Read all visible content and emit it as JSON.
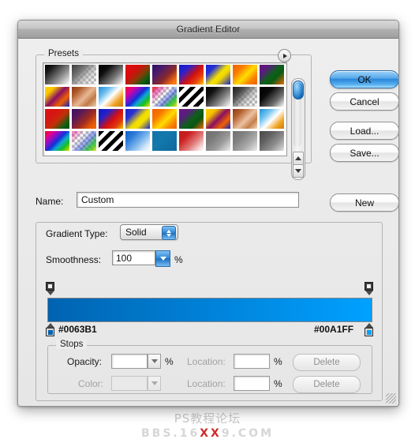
{
  "window": {
    "title": "Gradient Editor"
  },
  "presets": {
    "label": "Presets",
    "flyout_icon": "triangle-right-icon",
    "scrollbar": {
      "up_icon": "triangle-up-icon",
      "down_icon": "triangle-down-icon"
    },
    "swatches": [
      {
        "name": "black-white",
        "css": "linear-gradient(135deg,#000000 0%,#1a1a1a 22%,#8a8a8a 62%,#ffffff 100%)",
        "checker": false
      },
      {
        "name": "foreground-transparent",
        "css": "linear-gradient(135deg,#3a3a3a 0%,#6e6e6e 30%,rgba(160,160,160,0.45) 62%,rgba(255,255,255,0) 100%)",
        "checker": true
      },
      {
        "name": "black-white-2",
        "css": "linear-gradient(135deg,#000000 0%,#0d0d0d 28%,#7d7d7d 66%,#ffffff 100%)",
        "checker": false
      },
      {
        "name": "red-green",
        "css": "linear-gradient(135deg,#e01010 0%,#d40d0d 34%,#8a3a08 58%,#0d5c10 80%,#063a08 100%)",
        "checker": false
      },
      {
        "name": "violet-orange",
        "css": "linear-gradient(135deg,#2a1060 0%,#4a1a6e 28%,#8a2a28 60%,#f26a10 84%,#ff8c10 100%)",
        "checker": false
      },
      {
        "name": "blue-red-yellow",
        "css": "linear-gradient(135deg,#1418c8 0%,#2a20cc 26%,#d01010 56%,#e8400c 76%,#ffc800 100%)",
        "checker": false
      },
      {
        "name": "blue-yellow-blue",
        "css": "linear-gradient(135deg,#1a22cc 0%,#2430d8 24%,#f4e000 52%,#f0d800 64%,#1a22cc 100%)",
        "checker": false
      },
      {
        "name": "orange-yellow-orange",
        "css": "linear-gradient(135deg,#f06000 0%,#f87a00 26%,#ffdc00 54%,#f88000 78%,#ef5e00 100%)",
        "checker": false
      },
      {
        "name": "violet-green-orange",
        "css": "linear-gradient(135deg,#6a1070 0%,#5a1a80 22%,#0d6018 52%,#0a5a14 66%,#f06800 100%)",
        "checker": false
      },
      {
        "name": "yellow-violet-orange-blue",
        "css": "linear-gradient(135deg,#ffd400 0%,#f8c400 22%,#8a1060 48%,#f06000 72%,#1420c0 100%)",
        "checker": false
      },
      {
        "name": "copper",
        "css": "linear-gradient(135deg,#8a3a18 0%,#b05a2a 22%,#e8b894 52%,#c07a46 74%,#f0d0b4 100%)",
        "checker": false
      },
      {
        "name": "blue-white-orange",
        "css": "linear-gradient(135deg,#1e8ed8 0%,#6abdee 26%,#ffffff 50%,#f0a020 76%,#c87810 100%)",
        "checker": false
      },
      {
        "name": "spectrum",
        "css": "linear-gradient(135deg,#e01010 0%,#e8008c 18%,#8a10c8 34%,#1030d8 50%,#10a8d0 64%,#18c020 80%,#f0e000 100%)",
        "checker": false
      },
      {
        "name": "transparent-rainbow",
        "css": "linear-gradient(135deg,rgba(224,16,16,0.9) 0%,rgba(232,0,140,0.5) 20%,rgba(255,255,255,0) 42%,rgba(16,48,216,0.5) 62%,rgba(24,192,32,0.85) 80%,rgba(240,224,0,0.95) 100%)",
        "checker": true
      },
      {
        "name": "black-white-stripes",
        "css": "repeating-linear-gradient(135deg,#000000 0 5px,#ffffff 5px 10px)",
        "checker": true
      },
      {
        "name": "black-white-3",
        "css": "linear-gradient(135deg,#000000 0%,#111111 26%,#8a8a8a 66%,#ffffff 100%)",
        "checker": false
      },
      {
        "name": "black-transparent",
        "css": "linear-gradient(135deg,#1c1c1c 0%,#4a4a4a 28%,rgba(150,150,150,0.4) 62%,rgba(255,255,255,0) 100%)",
        "checker": true
      },
      {
        "name": "black-white-4",
        "css": "linear-gradient(135deg,#000000 0%,#0a0a0a 32%,#707070 70%,#ffffff 100%)",
        "checker": false
      },
      {
        "name": "red-orange-green",
        "css": "linear-gradient(135deg,#e01010 0%,#d81414 30%,#c03008 56%,#0d6014 82%,#08480f 100%)",
        "checker": false
      },
      {
        "name": "violet-red-orange",
        "css": "linear-gradient(135deg,#3a1060 0%,#5a1a58 28%,#a02a20 58%,#e85a08 82%,#f06a00 100%)",
        "checker": false
      },
      {
        "name": "blue-red-2",
        "css": "linear-gradient(135deg,#1418c0 0%,#2020cc 26%,#d41010 56%,#e03c0c 78%,#f0c000 100%)",
        "checker": false
      },
      {
        "name": "blue-yellow-2",
        "css": "linear-gradient(135deg,#1a22cc 0%,#2830d4 26%,#f0dc00 54%,#f4e000 68%,#1c24c8 100%)",
        "checker": false
      },
      {
        "name": "orange-yellow-2",
        "css": "linear-gradient(135deg,#f06000 0%,#f87800 28%,#ffdc00 56%,#f88400 80%,#ee5c00 100%)",
        "checker": false
      },
      {
        "name": "violet-green-2",
        "css": "linear-gradient(135deg,#701878 0%,#5c1a84 24%,#0d6018 54%,#0a5412 70%,#f06800 100%)",
        "checker": false
      },
      {
        "name": "yellow-violet-2",
        "css": "linear-gradient(135deg,#ffd400 0%,#f4c000 24%,#8a1060 50%,#f06000 74%,#1420c0 100%)",
        "checker": false
      },
      {
        "name": "copper-2",
        "css": "linear-gradient(135deg,#8a3a18 0%,#b4602e 24%,#ecc0a0 54%,#c4804c 76%,#f4d8bc 100%)",
        "checker": false
      },
      {
        "name": "blue-white-orange-2",
        "css": "linear-gradient(135deg,#1e8ed8 0%,#74c4f0 28%,#ffffff 52%,#f0a420 78%,#c87c10 100%)",
        "checker": false
      },
      {
        "name": "spectrum-2",
        "css": "linear-gradient(135deg,#e01010 0%,#e8008c 18%,#8a10c8 34%,#1030d8 50%,#10a8d0 64%,#18c020 80%,#f0e000 100%)",
        "checker": false
      },
      {
        "name": "transparent-rainbow-2",
        "css": "linear-gradient(135deg,rgba(232,0,140,0.55) 0%,rgba(255,255,255,0) 34%,rgba(16,48,216,0.45) 58%,rgba(24,192,32,0.8) 80%,rgba(240,224,0,0.9) 100%)",
        "checker": true
      },
      {
        "name": "black-stripes-2",
        "css": "repeating-linear-gradient(135deg,#000000 0 5px,#ffffff 5px 10px)",
        "checker": true
      },
      {
        "name": "blue-white-fade",
        "css": "linear-gradient(135deg,#1060c8 0%,#2a7ad8 26%,#7ab4ec 56%,#d0e6f8 80%,#ffffff 100%)",
        "checker": false
      },
      {
        "name": "steel-blue-solid",
        "css": "linear-gradient(135deg,#1272a8 0%,#1478ac 40%,#1070a4 70%,#0e6a9c 100%)",
        "checker": false
      },
      {
        "name": "red-white-fade",
        "css": "linear-gradient(135deg,#c01818 0%,#cc2020 28%,#e07a78 60%,#f4d4d4 84%,#ffffff 100%)",
        "checker": false
      },
      {
        "name": "grey-fade-1",
        "css": "linear-gradient(135deg,#6e6e6e 0%,#7a7a7a 30%,#9a9a9a 62%,#cfcfcf 86%,#efefef 100%)",
        "checker": false
      },
      {
        "name": "grey-fade-2",
        "css": "linear-gradient(135deg,#707070 0%,#828282 32%,#a8a8a8 64%,#d4d4d4 88%,#f0f0f0 100%)",
        "checker": false
      },
      {
        "name": "grey-fade-3",
        "css": "linear-gradient(135deg,#4a4a4a 0%,#5e5e5e 30%,#8e8e8e 64%,#c4c4c4 88%,#e8e8e8 100%)",
        "checker": false
      }
    ]
  },
  "buttons": {
    "ok": "OK",
    "cancel": "Cancel",
    "load": "Load...",
    "save": "Save...",
    "new": "New"
  },
  "name_field": {
    "label": "Name:",
    "value": "Custom"
  },
  "gradient_type": {
    "label": "Gradient Type:",
    "value": "Solid",
    "stepper_icon": "stepper-updown-icon"
  },
  "smoothness": {
    "label": "Smoothness:",
    "value": "100",
    "unit": "%",
    "dropdown_icon": "triangle-down-icon"
  },
  "gradient": {
    "start_hex": "#0063B1",
    "end_hex": "#00A1FF",
    "opacity_stop_icon": "opacity-stop-marker",
    "color_stop_icon": "color-stop-marker"
  },
  "stops": {
    "label": "Stops",
    "opacity": {
      "label": "Opacity:",
      "value": "",
      "unit": "%",
      "location_label": "Location:",
      "location_value": "",
      "location_unit": "%",
      "delete_label": "Delete"
    },
    "color": {
      "label": "Color:",
      "value": "",
      "location_label": "Location:",
      "location_value": "",
      "location_unit": "%",
      "delete_label": "Delete"
    }
  },
  "watermark": {
    "line1": "PS教程论坛",
    "line2_a": "BBS.16",
    "line2_red": "XX",
    "line2_b": "9.COM"
  }
}
